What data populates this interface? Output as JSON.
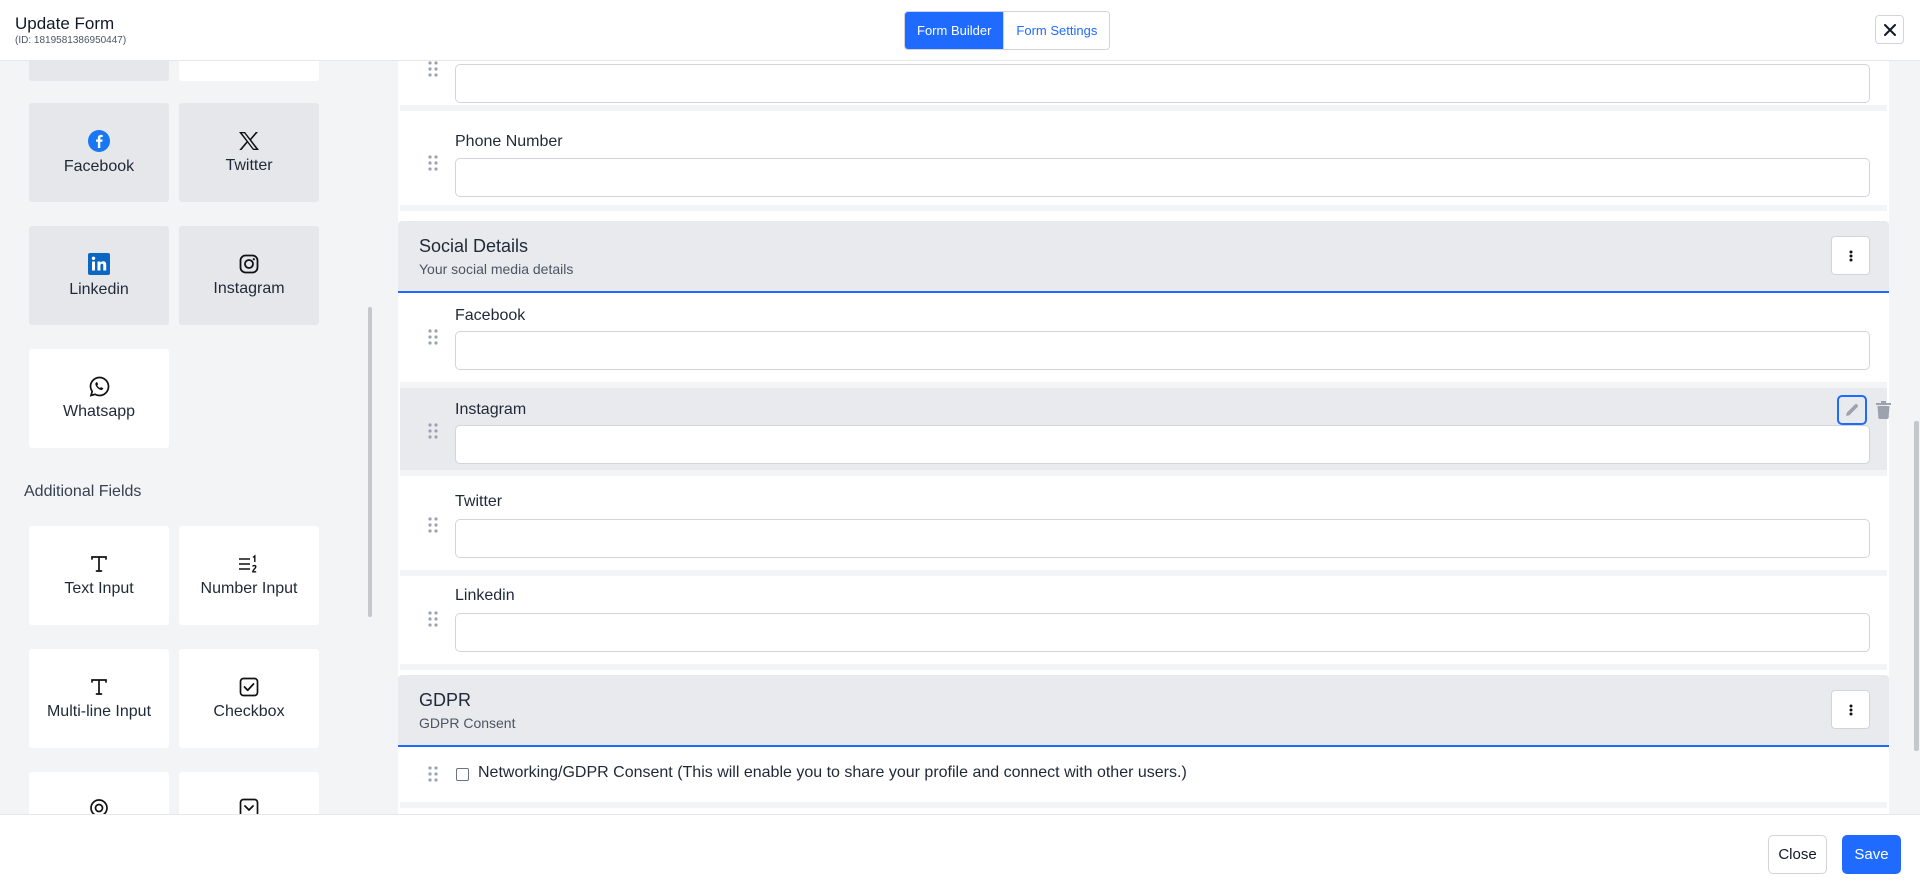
{
  "header": {
    "title": "Update Form",
    "subtitle": "(ID: 1819581386950447)",
    "tabs": [
      {
        "label": "Form Builder",
        "active": true
      },
      {
        "label": "Form Settings",
        "active": false
      }
    ],
    "close_icon": "close-icon"
  },
  "sidebar": {
    "social_items": [
      {
        "label": "Facebook",
        "icon": "facebook-icon"
      },
      {
        "label": "Twitter",
        "icon": "x-twitter-icon"
      },
      {
        "label": "Linkedin",
        "icon": "linkedin-icon"
      },
      {
        "label": "Instagram",
        "icon": "instagram-icon"
      },
      {
        "label": "Whatsapp",
        "icon": "whatsapp-icon"
      }
    ],
    "additional_heading": "Additional Fields",
    "additional_items": [
      {
        "label": "Text Input",
        "icon": "text-icon"
      },
      {
        "label": "Number Input",
        "icon": "number-list-icon"
      },
      {
        "label": "Multi-line Input",
        "icon": "text-icon"
      },
      {
        "label": "Checkbox",
        "icon": "checkbox-icon"
      }
    ]
  },
  "form": {
    "phone_label": "Phone Number",
    "social_group": {
      "title": "Social Details",
      "description": "Your social media details",
      "fields": [
        "Facebook",
        "Instagram",
        "Twitter",
        "Linkedin"
      ]
    },
    "gdpr_group": {
      "title": "GDPR",
      "description": "GDPR Consent",
      "consent_label": "Networking/GDPR Consent (This will enable you to share your profile and connect with other users.)"
    }
  },
  "footer": {
    "close_label": "Close",
    "save_label": "Save"
  },
  "colors": {
    "accent": "#1f6bff",
    "panel_bg": "#f3f4f6",
    "tinted_card": "#e5e7eb"
  }
}
